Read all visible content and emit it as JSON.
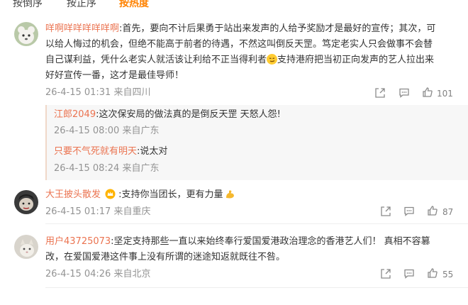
{
  "tabs": [
    {
      "label": "按倒序"
    },
    {
      "label": "按正序"
    },
    {
      "label": "按热度"
    }
  ],
  "comments": [
    {
      "user": "咩啊咩咩咩咩咩啊",
      "lines": [
        ":首先，要向不计后果勇于站出来发声的人给予奖励才是最好的宣传；其次，可",
        "以给人悔过的机会，但绝不能高于前者的待遇，不然这叫倒反天罡。笃定老实人只会做事不会替",
        "自己谋利益，凭什么老实人就活该让利给不正当得利者",
        "支持港府把当初正向发声的艺人拉出来",
        "好好宣传一番，这才是最佳导师！"
      ],
      "meta": "26-4-15 01:31 来自四川",
      "likes": "101",
      "replies": [
        {
          "user": "江郎2049",
          "text": ":这次保安局的做法真的是倒反天罡 天怒人怨!",
          "meta": "26-4-15 08:00 来自广东"
        },
        {
          "user": "只要不气死就有明天",
          "text": ":说太对",
          "meta": "26-4-15 08:24 来自广东"
        }
      ]
    },
    {
      "user": "大王披头散发",
      "text": ":支持你当团长，更有力量",
      "meta": "26-4-15 01:17 来自重庆",
      "likes": "87"
    },
    {
      "user": "用户43725073",
      "lines": [
        ":坚定支持那些一直以来始终奉行爱国爱港政治理念的香港艺人们！ 真相不容篡",
        "改，在爱国爱港这件事上没有所谓的迷途知返就既往不咎。"
      ],
      "meta": "26-4-15 04:26 来自北京",
      "likes": "55"
    }
  ],
  "icons": {
    "share": "share-icon",
    "comment": "comment-icon",
    "like": "thumbs-up-icon",
    "vip": "crown-badge-icon",
    "emoji_smile": "smirk-emoji-icon",
    "emoji_strong": "flexed-biceps-emoji-icon"
  },
  "colors": {
    "accent": "#ff8200",
    "username": "#eb7350",
    "meta": "#939393",
    "reply_bg": "#f7f7f7"
  }
}
